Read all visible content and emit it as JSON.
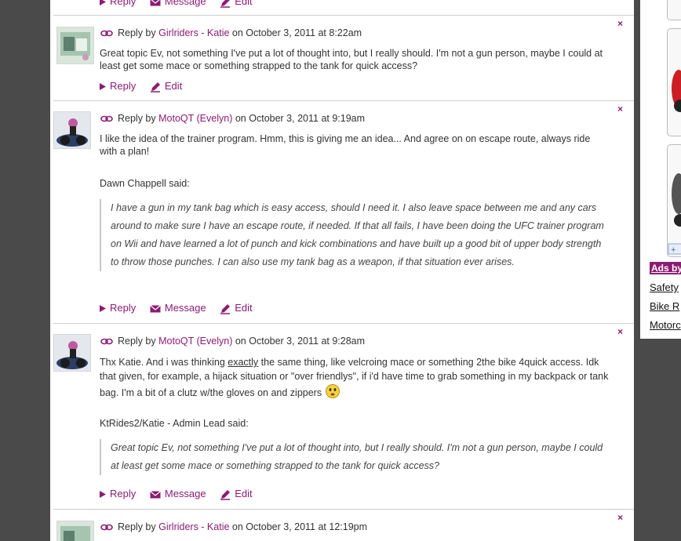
{
  "comments": [
    {
      "author": "Girlriders - Katie",
      "date": "October 3, 2011 at 8:22am",
      "body": "Great topic Ev, not something I've put a lot of thought into, but I really should.  I'm not a gun person, maybe I could at least get some mace or something strapped to the tank for quick access?"
    },
    {
      "author": "MotoQT (Evelyn)",
      "date": "October 3, 2011 at 9:19am",
      "body": "I like the idea of the trainer program. Hmm, this is giving me an idea... And agree on on escape route, always ride with a plan!",
      "quote_author": "Dawn Chappell said:",
      "quote": "I have a gun in my tank bag which is easy access, should I need it.  I also leave space between me and any cars around to make sure I have an escape route, if needed.  If that all fails, I have been doing the UFC trainer program on Wii and have learned a lot of punch and kick combinations and have built up a good bit of upper body strength to throw those punches.  I can also use my tank bag as a weapon, if that situation ever arises."
    },
    {
      "author": "MotoQT (Evelyn)",
      "date": "October 3, 2011 at 9:28am",
      "body_before": "Thx Katie. And i was thinking ",
      "body_emph": "exactly",
      "body_after": " the same thing, like velcroing mace or something 2the bike 4quick access. Idk that given, for example, a hijack situation or \"over friendlys\", if i'd have time to grab something in my backpack or tank bag. I'm a bit of a clutz w/the gloves on and zippers",
      "quote_author": "KtRides2/Katie - Admin Lead said:",
      "quote": "Great topic Ev, not something I've put a lot of thought into, but I really should.  I'm not a gun person, maybe I could at least get some mace or something strapped to the tank for quick access?"
    },
    {
      "author": "Girlriders - Katie",
      "date": "October 3, 2011 at 12:19pm"
    }
  ],
  "labels": {
    "reply_by": "Reply by",
    "on": "on",
    "reply": "Reply",
    "message": "Message",
    "edit": "Edit",
    "close": "×"
  },
  "sidebar": {
    "ads_by": "Ads by",
    "links": [
      "Safety",
      "Bike R",
      "Motorc"
    ],
    "plus": "+"
  },
  "colors": {
    "accent": "#8d1b73",
    "background": "#4a4a4a"
  }
}
